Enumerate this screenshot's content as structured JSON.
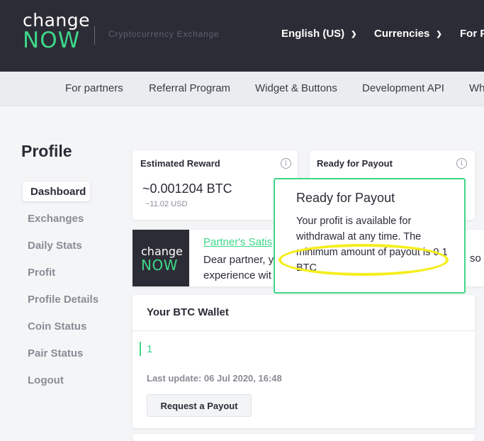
{
  "header": {
    "logo_line1": "change",
    "logo_line2": "NOW",
    "tagline": "Cryptocurrency Exchange",
    "nav": [
      {
        "label": "English (US)",
        "has_dropdown": true
      },
      {
        "label": "Currencies",
        "has_dropdown": true
      },
      {
        "label": "For P",
        "has_dropdown": false
      }
    ]
  },
  "subnav": {
    "items": [
      "For partners",
      "Referral Program",
      "Widget & Buttons",
      "Development API",
      "Wh"
    ]
  },
  "sidebar": {
    "title": "Profile",
    "items": [
      {
        "label": "Dashboard",
        "active": true
      },
      {
        "label": "Exchanges"
      },
      {
        "label": "Daily Stats"
      },
      {
        "label": "Profit"
      },
      {
        "label": "Profile Details"
      },
      {
        "label": "Coin Status"
      },
      {
        "label": "Pair Status"
      },
      {
        "label": "Logout"
      }
    ]
  },
  "cards": {
    "estimated_reward": {
      "label": "Estimated Reward",
      "value": "~0.001204 BTC",
      "usd": "~11.02 USD",
      "info_icon": "info-icon"
    },
    "ready_for_payout": {
      "label": "Ready for Payout",
      "info_icon": "info-icon"
    }
  },
  "partner": {
    "logo_line1": "change",
    "logo_line2": "NOW",
    "link": "Partner's Satis",
    "text_line1": "Dear partner, y",
    "text_line2": "experience wit",
    "text_tail": "so"
  },
  "wallet": {
    "title": "Your BTC Wallet",
    "input_value": "1",
    "last_update": "Last update: 06 Jul 2020, 16:48",
    "payout_button": "Request a Payout"
  },
  "tooltip": {
    "title": "Ready for Payout",
    "body": "Your profit is available for withdrawal at any time. The minimum amount of payout is 0.1 BTC"
  },
  "colors": {
    "accent": "#3ed788",
    "header_bg": "#2c2c36",
    "highlight": "#f5ee1e"
  }
}
